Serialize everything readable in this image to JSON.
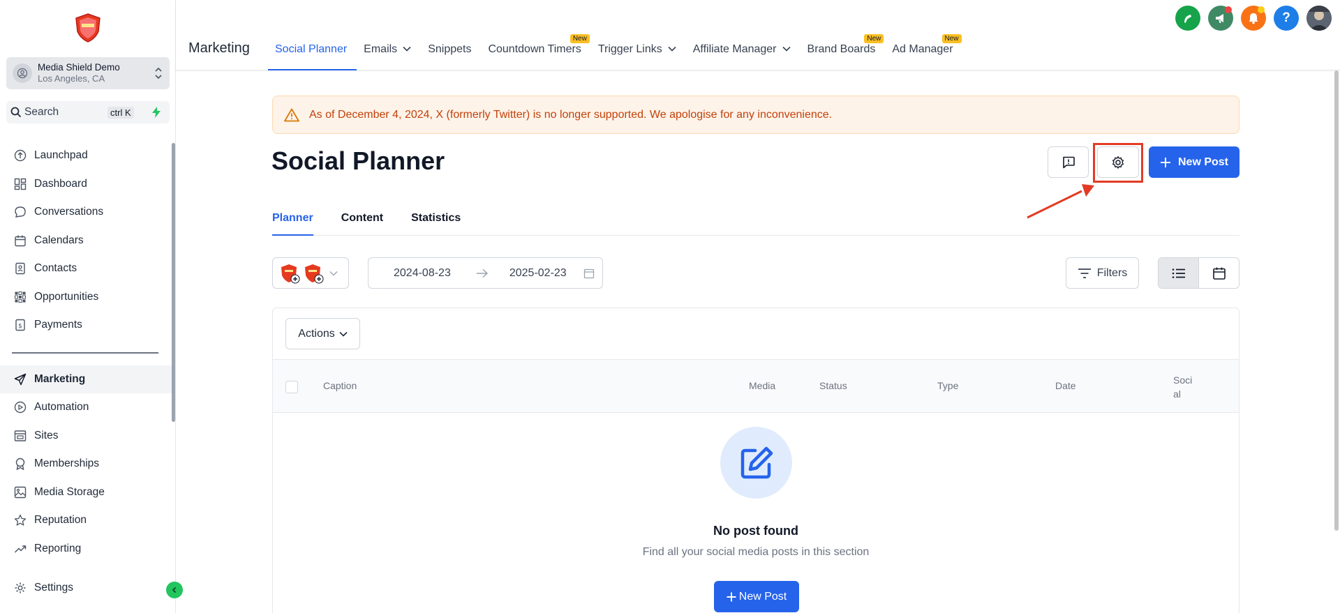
{
  "account": {
    "name": "Media Shield Demo",
    "location": "Los Angeles, CA"
  },
  "search": {
    "label": "Search",
    "shortcut": "ctrl K"
  },
  "sidebar": {
    "items": [
      {
        "label": "Launchpad",
        "icon": "launchpad-icon"
      },
      {
        "label": "Dashboard",
        "icon": "dashboard-icon"
      },
      {
        "label": "Conversations",
        "icon": "chat-icon"
      },
      {
        "label": "Calendars",
        "icon": "calendar-icon"
      },
      {
        "label": "Contacts",
        "icon": "contacts-icon"
      },
      {
        "label": "Opportunities",
        "icon": "opportunities-icon"
      },
      {
        "label": "Payments",
        "icon": "payments-icon"
      },
      {
        "label": "Marketing",
        "icon": "send-icon",
        "active": true
      },
      {
        "label": "Automation",
        "icon": "automation-icon"
      },
      {
        "label": "Sites",
        "icon": "sites-icon"
      },
      {
        "label": "Memberships",
        "icon": "memberships-icon"
      },
      {
        "label": "Media Storage",
        "icon": "image-icon"
      },
      {
        "label": "Reputation",
        "icon": "star-icon"
      },
      {
        "label": "Reporting",
        "icon": "trend-icon"
      }
    ],
    "settings_label": "Settings"
  },
  "topbar": {
    "section": "Marketing",
    "tabs": [
      {
        "label": "Social Planner",
        "active": true
      },
      {
        "label": "Emails",
        "dropdown": true
      },
      {
        "label": "Snippets"
      },
      {
        "label": "Countdown Timers",
        "badge": "New"
      },
      {
        "label": "Trigger Links",
        "dropdown": true
      },
      {
        "label": "Affiliate Manager",
        "dropdown": true
      },
      {
        "label": "Brand Boards",
        "badge": "New"
      },
      {
        "label": "Ad Manager",
        "badge": "New"
      }
    ],
    "icon_colors": {
      "phone": "#16a34a",
      "megaphone": "#3f8a64",
      "bell": "#f97316",
      "help": "#1d7ee8"
    }
  },
  "alert": {
    "text": "As of December 4, 2024, X (formerly Twitter) is no longer supported. We apologise for any inconvenience."
  },
  "page": {
    "title": "Social Planner",
    "new_post_label": "New Post",
    "subtabs": [
      "Planner",
      "Content",
      "Statistics"
    ],
    "date_start": "2024-08-23",
    "date_end": "2025-02-23",
    "filters_label": "Filters",
    "actions_label": "Actions",
    "columns": [
      "Caption",
      "Media",
      "Status",
      "Type",
      "Date",
      "Soci\nal"
    ],
    "empty": {
      "title": "No post found",
      "subtitle": "Find all your social media posts in this section",
      "button_label": "New Post"
    }
  },
  "colors": {
    "primary": "#2563eb",
    "highlight": "#e23b25",
    "alert_text": "#c2410c",
    "alert_bg": "#fef3e8"
  }
}
